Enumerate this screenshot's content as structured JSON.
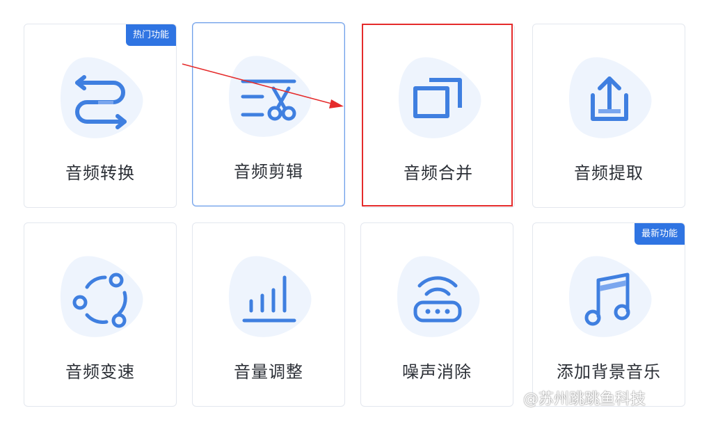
{
  "cards": [
    {
      "label": "音频转换",
      "icon": "convert-arrows-icon",
      "badge": "热门功能"
    },
    {
      "label": "音频剪辑",
      "icon": "scissors-edit-icon",
      "badge": ""
    },
    {
      "label": "音频合并",
      "icon": "merge-windows-icon",
      "badge": ""
    },
    {
      "label": "音频提取",
      "icon": "extract-upload-icon",
      "badge": ""
    },
    {
      "label": "音频变速",
      "icon": "speed-circle-icon",
      "badge": ""
    },
    {
      "label": "音量调整",
      "icon": "volume-bars-icon",
      "badge": ""
    },
    {
      "label": "噪声消除",
      "icon": "noise-wifi-icon",
      "badge": ""
    },
    {
      "label": "添加背景音乐",
      "icon": "music-note-icon",
      "badge": "最新功能"
    }
  ],
  "watermark": "@苏州跳跳鱼科技",
  "colors": {
    "accent": "#2f74e2",
    "icon_blue": "#3f7fe0",
    "blob": "#eef4fd",
    "highlight_red": "#e52b2b"
  }
}
